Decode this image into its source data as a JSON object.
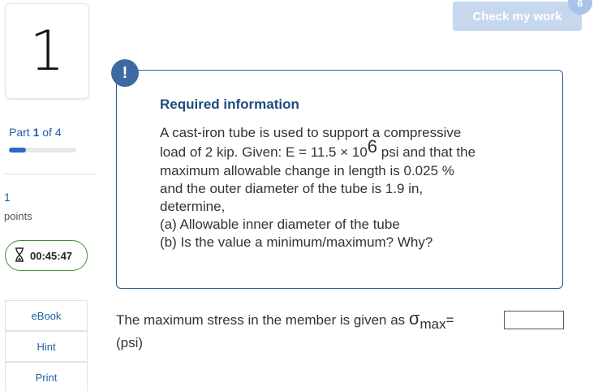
{
  "question": {
    "number": "1",
    "part_label": "Part",
    "part_current": "1",
    "part_of": "of 4",
    "part_progress": 0.25,
    "points_value": "1",
    "points_label": "points",
    "timer": "00:45:47"
  },
  "side_buttons": {
    "ebook": "eBook",
    "hint": "Hint",
    "print": "Print"
  },
  "header": {
    "check_label": "Check my work",
    "check_badge": "6"
  },
  "info": {
    "alert_symbol": "!",
    "title": "Required information",
    "line1": "A cast-iron tube is used to support a compressive",
    "line2_pre": "load of 2 kip. Given: E = 11.5 × 10",
    "line2_exp": "6",
    "line2_post": " psi and that the",
    "line3": "maximum allowable change in length is 0.025 %",
    "line4": "and the outer diameter of the tube is 1.9 in,",
    "line5": "determine,",
    "line6": "(a) Allowable inner diameter of the tube",
    "line7": "(b) Is the value a minimum/maximum? Why?"
  },
  "prompt": {
    "text": "The maximum stress in the member is given as ",
    "symbol": "σ",
    "subscript": "max",
    "equals": "=",
    "input_value": "",
    "unit": "(psi)"
  },
  "colors": {
    "accent_blue": "#1f5fa8",
    "box_border": "#2c5c8f",
    "timer_border": "#4a8a3c",
    "check_button": "#c7d8ee"
  }
}
